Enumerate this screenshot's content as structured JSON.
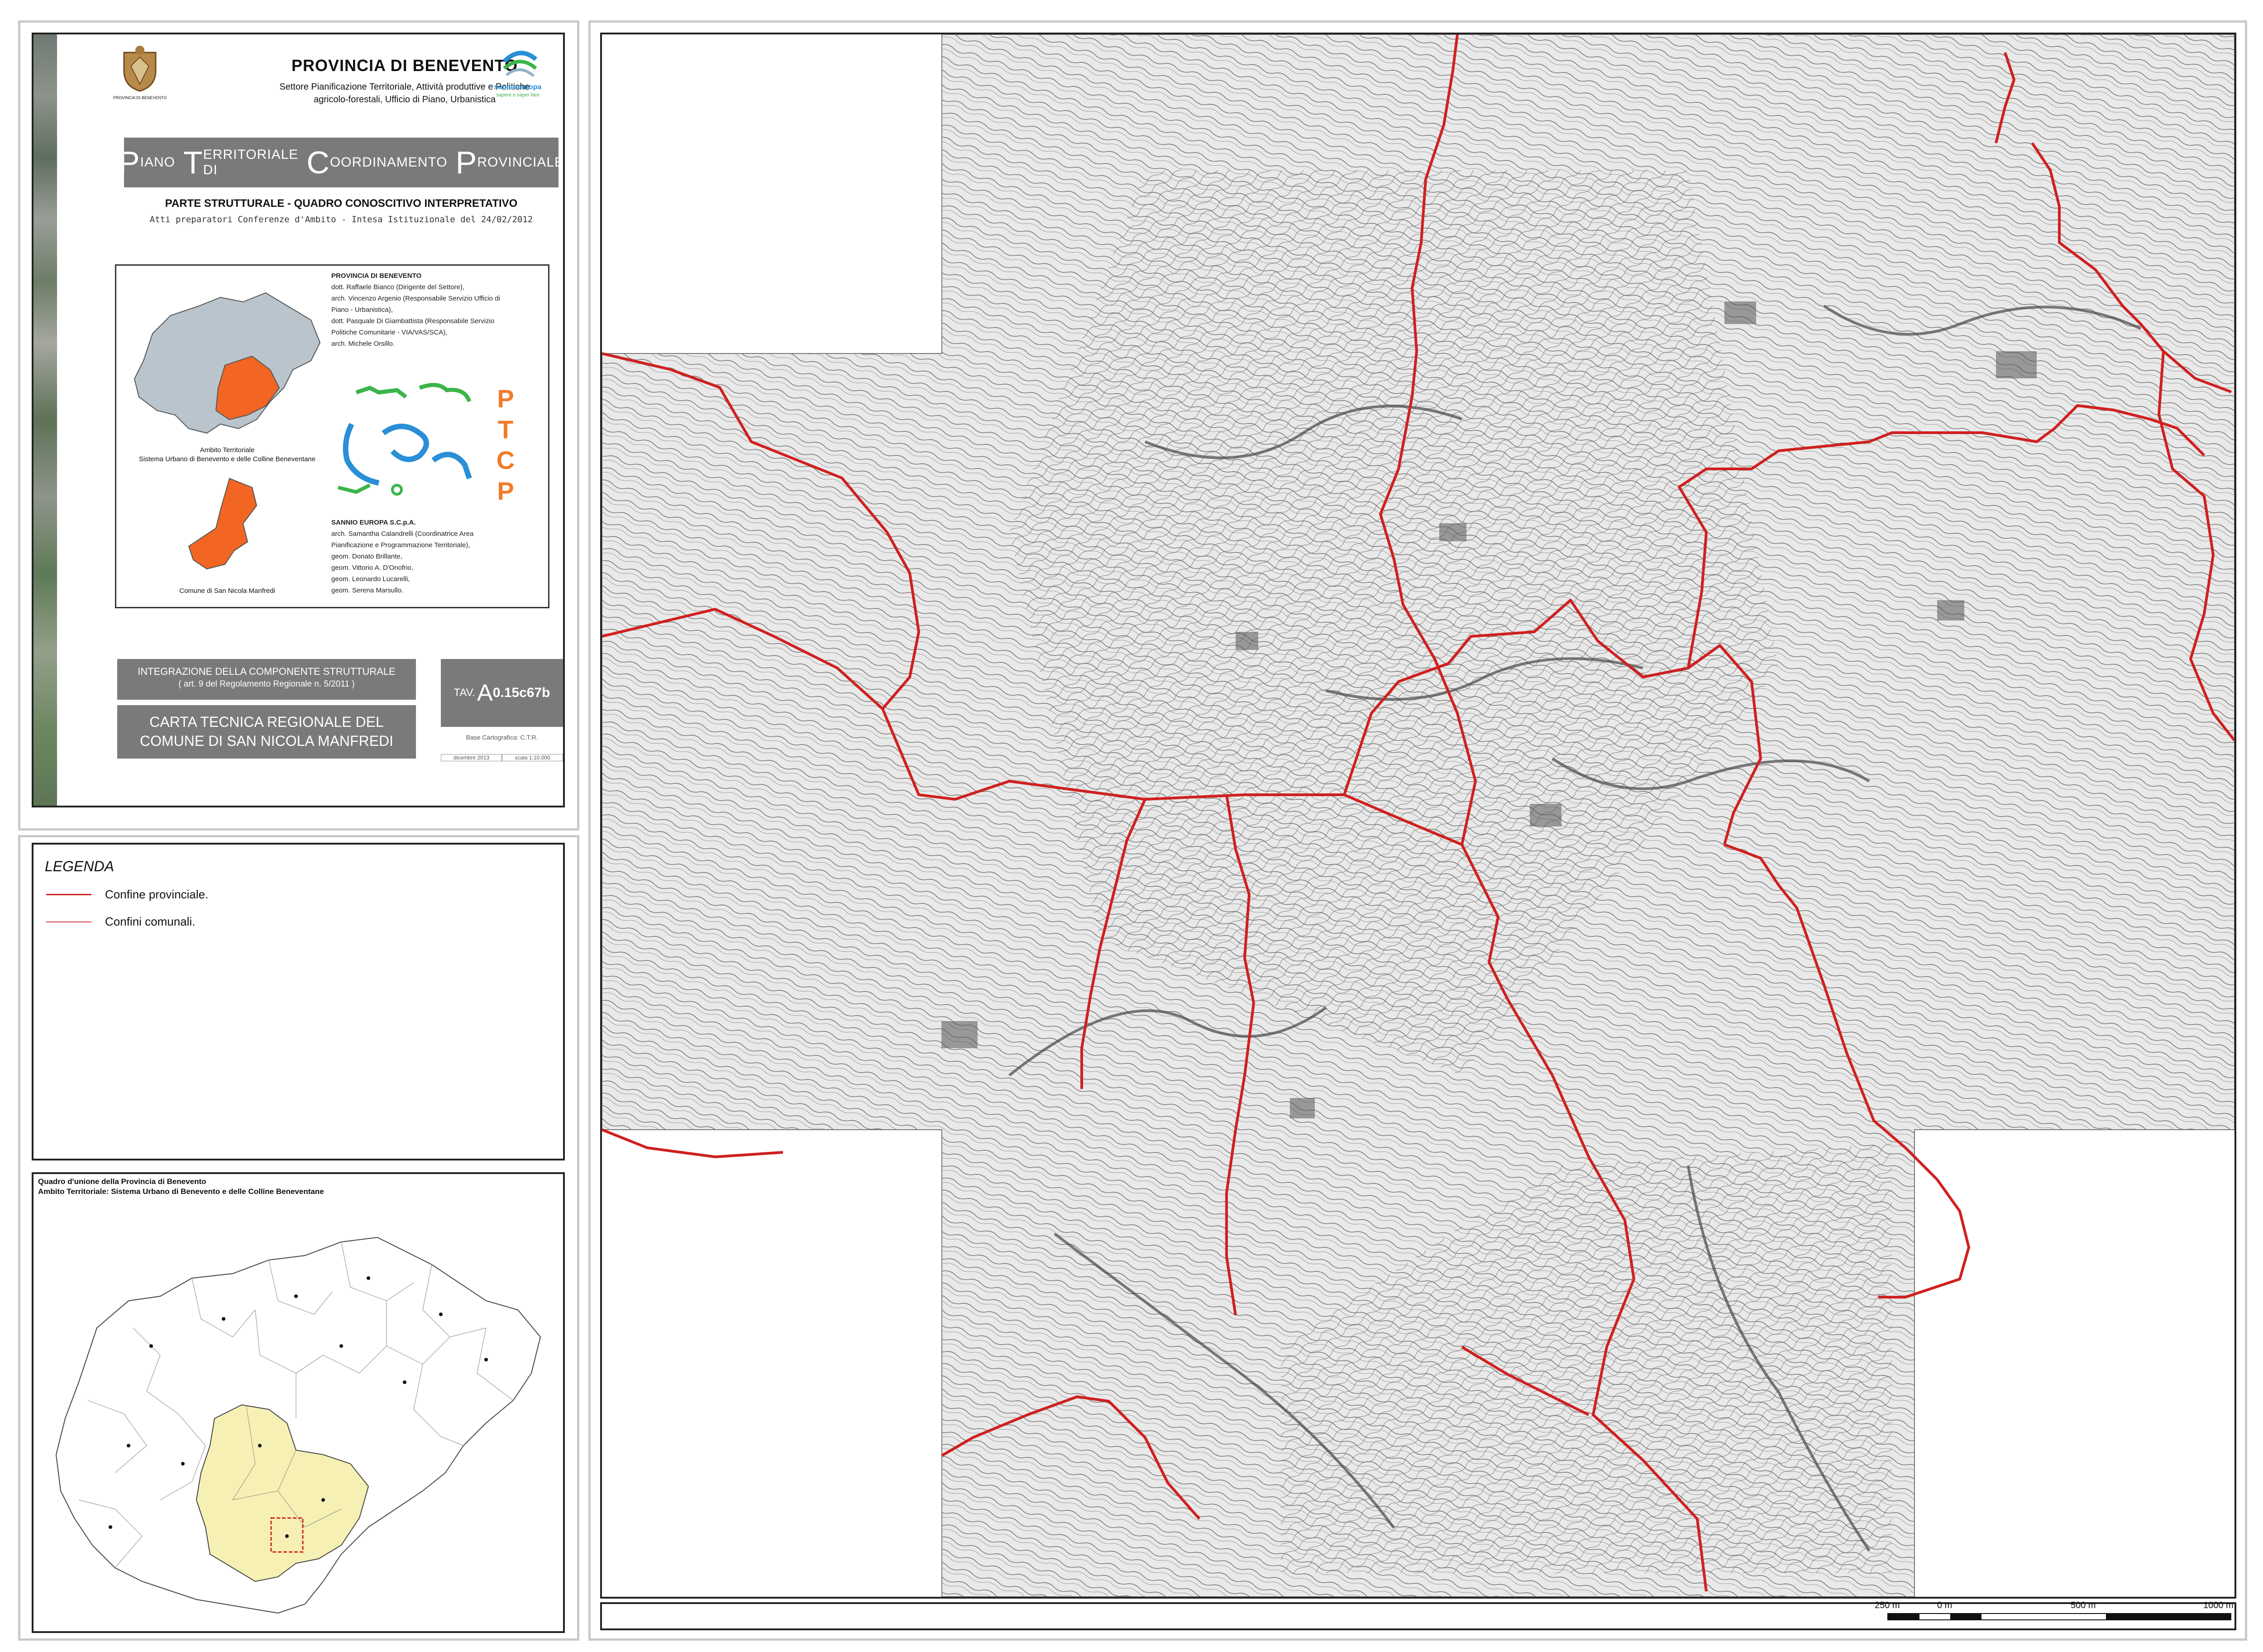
{
  "header": {
    "org": "PROVINCIA DI BENEVENTO",
    "sector_line1": "Settore Pianificazione Territoriale, Attività produttive e Politiche",
    "sector_line2": "agricolo-forestali, Ufficio di Piano, Urbanistica",
    "left_logo_caption": "PROVINCIA DI BENEVENTO",
    "right_logo_name": "sannioeuropa",
    "right_logo_tagline": "sapere e saper fare"
  },
  "plan": {
    "word1_initial": "P",
    "word1_rest": "IANO",
    "word2_initial": "T",
    "word2_rest": "ERRITORIALE DI",
    "word3_initial": "C",
    "word3_rest": "OORDINAMENTO",
    "word4_initial": "P",
    "word4_rest": "ROVINCIALE",
    "section": "PARTE STRUTTURALE - QUADRO CONOSCITIVO INTERPRETATIVO",
    "acts": "Atti preparatori Conferenze d'Ambito - Intesa Istituzionale del 24/02/2012"
  },
  "credits": {
    "provincia_heading": "PROVINCIA DI BENEVENTO",
    "provincia_lines": [
      "dott. Raffaele Bianco (Dirigente del Settore),",
      "arch. Vincenzo Argenio (Responsabile Servizio Ufficio di",
      "Piano - Urbanistica),",
      "dott. Pasquale Di Giambattista (Responsabile Servizio",
      "Politiche Comunitarie - VIA/VAS/SCA),",
      "arch. Michele Orsillo."
    ],
    "sannio_heading": "SANNIO EUROPA S.C.p.A.",
    "sannio_lines": [
      "arch. Samantha Calandrelli (Coordinatrice Area",
      "Pianificazione e Programmazione Territoriale),",
      "geom. Donato Brillante,",
      "geom. Vittorio A. D'Onofrio,",
      "geom. Leonardo Lucarelli,",
      "geom. Serena Marsullo."
    ],
    "ambito_line1": "Ambito Territoriale",
    "ambito_line2": "Sistema Urbano di Benevento e delle Colline Beneventane",
    "comune_caption": "Comune di San Nicola Manfredi",
    "ptcp_letters": [
      "P",
      "T",
      "C",
      "P"
    ]
  },
  "title_block": {
    "integration_line1": "INTEGRAZIONE DELLA COMPONENTE STRUTTURALE",
    "integration_line2": "( art. 9 del Regolamento Regionale n. 5/2011 )",
    "map_title_line1": "CARTA TECNICA REGIONALE DEL",
    "map_title_line2": "COMUNE DI SAN NICOLA MANFREDI",
    "tav_prefix": "TAV.",
    "tav_letter": "A",
    "tav_code": "0.15c67b",
    "base": "Base Cartografica: C.T.R.",
    "date": "dicembre 2013",
    "scale": "scala 1:10.000"
  },
  "legend": {
    "title": "LEGENDA",
    "items": [
      {
        "label": "Confine provinciale.",
        "color": "#d02020"
      },
      {
        "label": "Confini comunali.",
        "color": "#d04040"
      }
    ]
  },
  "quadro": {
    "line1": "Quadro d'unione della Provincia di Benevento",
    "line2": "Ambito Territoriale: Sistema Urbano di Benevento e delle Colline Beneventane"
  },
  "scale_bar": {
    "labels": [
      "250 m",
      "0 m",
      "500 m",
      "1000 m"
    ]
  },
  "colors": {
    "accent_gray": "#7a7a7a",
    "boundary_red": "#d02020",
    "region_orange": "#f26522",
    "province_gray": "#b9c4cc",
    "ambito_yellow": "#f6f0b4",
    "ptcp_green": "#3cb54a",
    "ptcp_blue": "#2a8fd6",
    "ptcp_orange": "#f07b2a"
  }
}
